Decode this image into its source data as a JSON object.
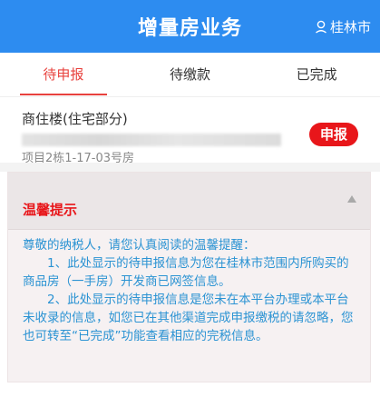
{
  "header": {
    "title": "增量房业务",
    "city": "桂林市",
    "location_icon": "location-pin-icon",
    "background_color": "#2d8cf0"
  },
  "tabs": [
    {
      "label": "待申报",
      "active": true
    },
    {
      "label": "待缴款",
      "active": false
    },
    {
      "label": "已完成",
      "active": false
    }
  ],
  "record": {
    "house_type": "商住楼(住宅部分)",
    "project": "项目2栋1-17-03号房",
    "action_label": "申报",
    "action_color": "#e8161a"
  },
  "tips": {
    "title": "温馨提示",
    "collapse_icon": "triangle-up-icon",
    "greeting": "尊敬的纳税人，请您认真阅读的温馨提醒：",
    "item1": "1、此处显示的待申报信息为您在桂林市范围内所购买的商品房（一手房）开发商已网签信息。",
    "item2": "2、此处显示的待申报信息是您未在本平台办理或本平台未收录的信息，如您已在其他渠道完成申报缴税的请忽略，您也可转至“已完成”功能查看相应的完税信息。",
    "title_color": "#e8161a",
    "text_color": "#2b93d3"
  }
}
